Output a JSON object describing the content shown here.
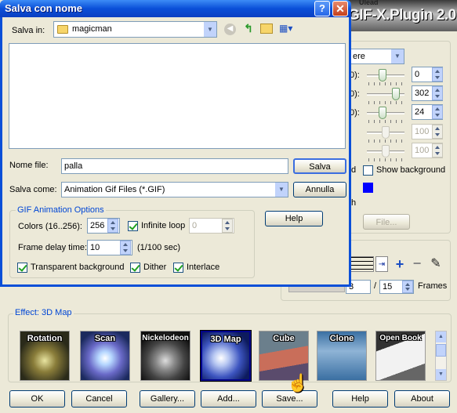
{
  "background_app": {
    "title": "GIF-X.Plugin 2.0",
    "brand_small": "Ulead",
    "dropdown_value": "ere",
    "param_labels": [
      "0):",
      "0):",
      "0):"
    ],
    "sliders": [
      {
        "value": "0",
        "level": 0.4,
        "enabled": true
      },
      {
        "value": "302",
        "level": 0.85,
        "enabled": true
      },
      {
        "value": "24",
        "level": 0.4,
        "enabled": true
      },
      {
        "value": "100",
        "level": 0.5,
        "enabled": false
      },
      {
        "value": "100",
        "level": 0.5,
        "enabled": false
      }
    ],
    "show_background_label": "Show background",
    "d_label": "d",
    "h_label": "h",
    "file_button": "File...",
    "frame_current": "3",
    "frame_total": "15",
    "frames_label": "Frames",
    "frame_sep": "/",
    "effect_group_title": "Effect: 3D Map",
    "effects": [
      {
        "label": "Rotation"
      },
      {
        "label": "Scan"
      },
      {
        "label": "Nickelodeon"
      },
      {
        "label": "3D Map"
      },
      {
        "label": "Cube"
      },
      {
        "label": "Clone"
      },
      {
        "label": "Open Book"
      }
    ],
    "bottom_buttons": {
      "ok": "OK",
      "cancel": "Cancel",
      "gallery": "Gallery...",
      "add": "Add...",
      "save": "Save...",
      "help": "Help",
      "about": "About"
    }
  },
  "dialog": {
    "title": "Salva con nome",
    "save_in_label": "Salva in:",
    "save_in_value": "magicman",
    "file_name_label": "Nome file:",
    "file_name_value": "palla",
    "save_as_label": "Salva come:",
    "save_as_value": "Animation Gif Files (*.GIF)",
    "save_button": "Salva",
    "cancel_button": "Annulla",
    "help_button": "Help",
    "gif_group_title": "GIF Animation Options",
    "colors_label": "Colors (16..256):",
    "colors_value": "256",
    "infinite_loop_label": "Infinite loop",
    "infinite_loop_checked": true,
    "loop_value": "0",
    "frame_delay_label": "Frame delay time:",
    "frame_delay_value": "10",
    "frame_delay_unit": "(1/100 sec)",
    "transparent_bg_label": "Transparent background",
    "transparent_bg_checked": true,
    "dither_label": "Dither",
    "dither_checked": true,
    "interlace_label": "Interlace",
    "interlace_checked": true
  },
  "colors": {
    "titlebar": "#0a4fd8",
    "accent_blue": "#0000ff",
    "group_title": "#0046d5"
  }
}
